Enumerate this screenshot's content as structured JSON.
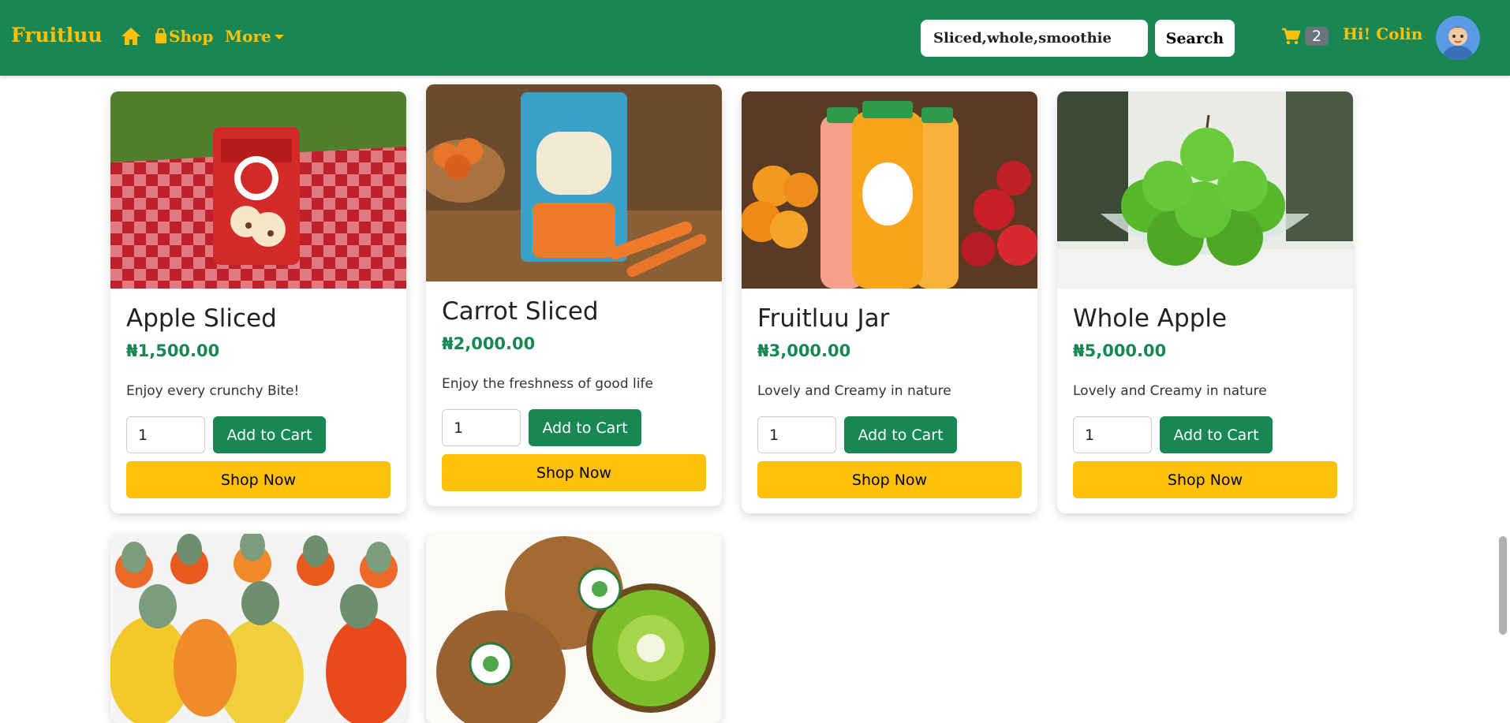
{
  "nav": {
    "brand": "Fruitluu",
    "shop_label": "Shop",
    "more_label": "More",
    "search_value": "Sliced,whole,smoothie",
    "search_button": "Search",
    "cart_count": "2",
    "greeting": "Hi! Colin"
  },
  "colors": {
    "primary": "#198754",
    "accent": "#ffc107",
    "badge": "#6c757d"
  },
  "products": [
    {
      "title": "Apple Sliced",
      "price": "₦1,500.00",
      "description": "Enjoy every crunchy Bite!",
      "quantity": "1",
      "add_label": "Add to Cart",
      "shop_label": "Shop Now"
    },
    {
      "title": "Carrot Sliced",
      "price": "₦2,000.00",
      "description": "Enjoy the freshness of good life",
      "quantity": "1",
      "add_label": "Add to Cart",
      "shop_label": "Shop Now"
    },
    {
      "title": "Fruitluu Jar",
      "price": "₦3,000.00",
      "description": "Lovely and Creamy in nature",
      "quantity": "1",
      "add_label": "Add to Cart",
      "shop_label": "Shop Now"
    },
    {
      "title": "Whole Apple",
      "price": "₦5,000.00",
      "description": "Lovely and Creamy in nature",
      "quantity": "1",
      "add_label": "Add to Cart",
      "shop_label": "Shop Now"
    }
  ]
}
